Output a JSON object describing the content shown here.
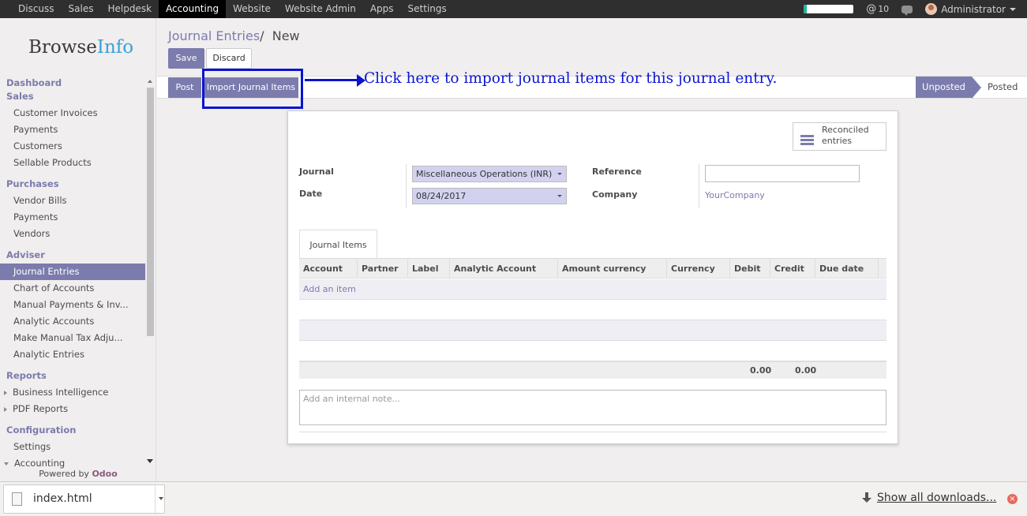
{
  "topbar": {
    "menu": [
      "Discuss",
      "Sales",
      "Helpdesk",
      "Accounting",
      "Website",
      "Website Admin",
      "Apps",
      "Settings"
    ],
    "active": "Accounting",
    "progress": 0.06,
    "mentions_count": "10",
    "at_symbol": "@",
    "user_name": "Administrator"
  },
  "sidebar": {
    "logo_browse": "Browse",
    "logo_info": "Info",
    "dashboard": "Dashboard",
    "sales": {
      "title": "Sales",
      "items": [
        "Customer Invoices",
        "Payments",
        "Customers",
        "Sellable Products"
      ]
    },
    "purchases": {
      "title": "Purchases",
      "items": [
        "Vendor Bills",
        "Payments",
        "Vendors"
      ]
    },
    "adviser": {
      "title": "Adviser",
      "items": [
        "Journal Entries",
        "Chart of Accounts",
        "Manual Payments & Inv...",
        "Analytic Accounts",
        "Make Manual Tax Adju...",
        "Analytic Entries"
      ]
    },
    "reports": {
      "title": "Reports",
      "items": [
        "Business Intelligence",
        "PDF Reports"
      ]
    },
    "configuration": {
      "title": "Configuration",
      "items": [
        "Settings",
        "Accounting"
      ]
    },
    "powered_by": "Powered by",
    "odoo": "Odoo"
  },
  "main": {
    "breadcrumb_parent": "Journal Entries",
    "breadcrumb_sep": "/",
    "breadcrumb_current": "New",
    "save": "Save",
    "discard": "Discard",
    "post": "Post",
    "import_items": "Import Journal Items",
    "status_unposted": "Unposted",
    "status_posted": "Posted",
    "annotation": "Click here to import journal items for this journal entry."
  },
  "form": {
    "reconciled_line1": "Reconciled",
    "reconciled_line2": "entries",
    "journal_label": "Journal",
    "journal_value": "Miscellaneous Operations (INR)",
    "date_label": "Date",
    "date_value": "08/24/2017",
    "reference_label": "Reference",
    "company_label": "Company",
    "company_value": "YourCompany",
    "tab_label": "Journal Items",
    "columns": [
      "Account",
      "Partner",
      "Label",
      "Analytic Account",
      "Amount currency",
      "Currency",
      "Debit",
      "Credit",
      "Due date"
    ],
    "add_item": "Add an item",
    "total_debit": "0.00",
    "total_credit": "0.00",
    "note_placeholder": "Add an internal note..."
  },
  "downloads": {
    "file_name": "index.html",
    "show_all": "Show all downloads...",
    "close_symbol": "×"
  }
}
